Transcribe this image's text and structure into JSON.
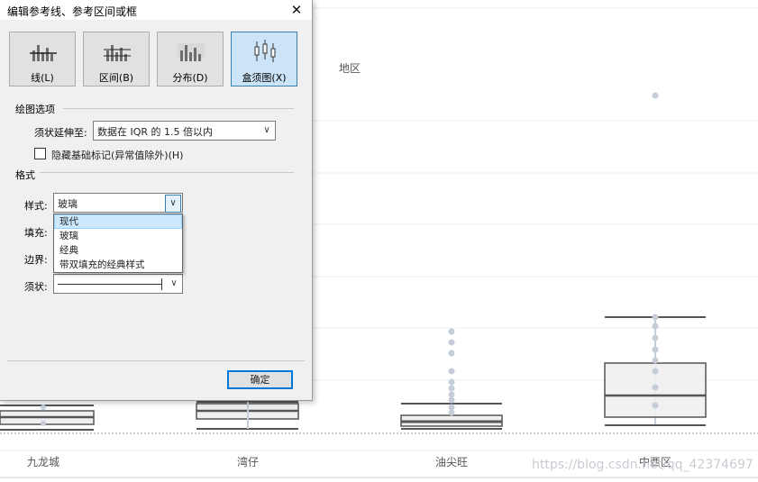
{
  "dialog": {
    "title": "编辑参考线、参考区间或框",
    "type_buttons": [
      {
        "label": "线(L)",
        "icon": "line-bars-icon"
      },
      {
        "label": "区间(B)",
        "icon": "band-bars-icon"
      },
      {
        "label": "分布(D)",
        "icon": "distribution-bars-icon"
      },
      {
        "label": "盒须图(X)",
        "icon": "boxplot-icon",
        "active": true
      }
    ],
    "plot_options_label": "绘图选项",
    "whisker_extend_label": "须状延伸至:",
    "whisker_extend_value": "数据在 IQR 的 1.5 倍以内",
    "hide_marks_label": "隐藏基础标记(异常值除外)(H)",
    "hide_marks_checked": false,
    "format_label": "格式",
    "style_label": "样式:",
    "style_value": "玻璃",
    "style_options": [
      "现代",
      "玻璃",
      "经典",
      "带双填充的经典样式"
    ],
    "style_highlighted": "现代",
    "fill_label": "填充:",
    "border_label": "边界:",
    "whisker_label": "须状:",
    "ok_label": "确定"
  },
  "chart": {
    "axis_title": "地区",
    "categories": [
      "九龙城",
      "湾仔",
      "油尖旺",
      "中西区"
    ],
    "watermark": "https://blog.csdn.net/qq_42374697",
    "colors": {
      "box_border": "#555555",
      "median": "#555555",
      "box_fill": "#efefef",
      "points": "#c5ced8"
    }
  }
}
